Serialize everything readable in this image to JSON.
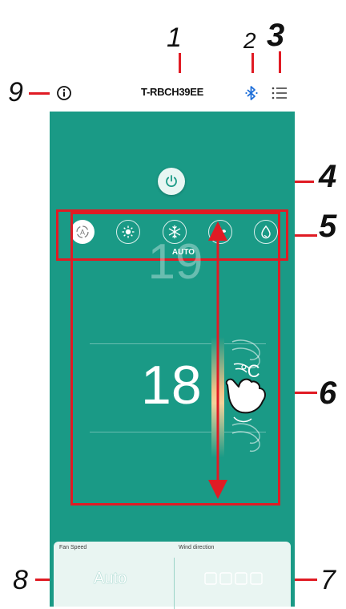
{
  "callouts": [
    "1",
    "2",
    "3",
    "4",
    "5",
    "6",
    "7",
    "8",
    "9"
  ],
  "app": {
    "title": "T-RBCH39EE",
    "mode_selected_label": "AUTO",
    "temp_previous": "19",
    "temp_current": "18",
    "temp_unit": "°C",
    "fan_speed_label": "Fan Speed",
    "fan_speed_value": "Auto",
    "wind_direction_label": "Wind direction"
  },
  "icons": {
    "info": "info-icon",
    "bluetooth": "bluetooth-icon",
    "menu": "menu-icon",
    "power": "power-icon",
    "modes": [
      "auto-mode-icon",
      "heat-mode-icon",
      "cool-mode-icon",
      "fan-mode-icon",
      "dry-mode-icon"
    ],
    "gesture": "swipe-gesture-icon",
    "wind": "wind-direction-icon"
  },
  "colors": {
    "app_background": "#1a9a86",
    "annotation": "#e01b24",
    "bluetooth": "#1e6fd9"
  }
}
